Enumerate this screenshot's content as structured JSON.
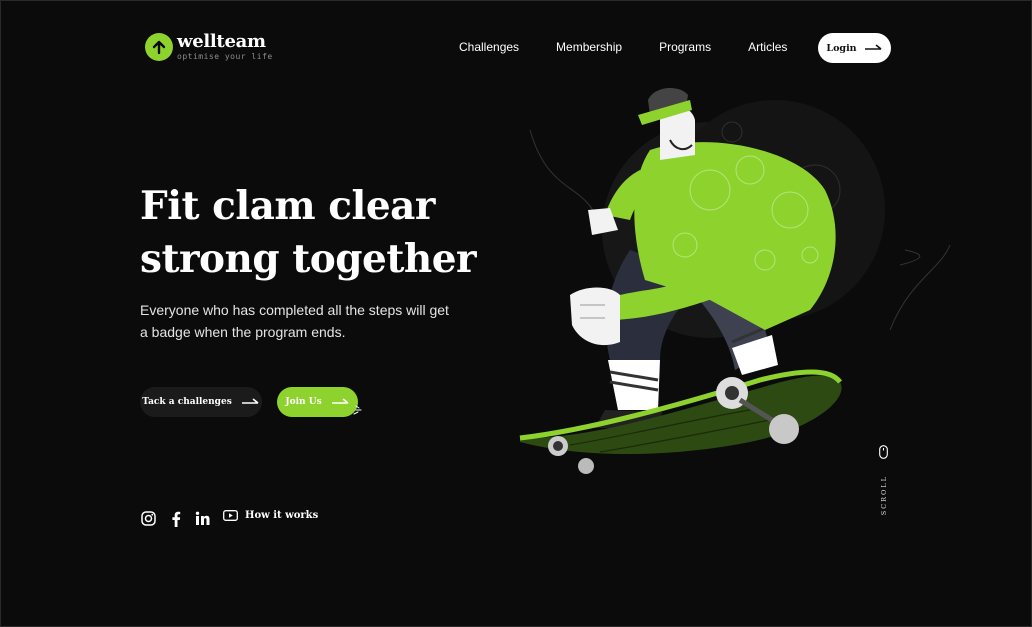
{
  "brand": {
    "name": "wellteam",
    "tagline": "optimise your life",
    "accent": "#8ed22d"
  },
  "nav": {
    "items": [
      "Challenges",
      "Membership",
      "Programs",
      "Articles"
    ],
    "login_label": "Login"
  },
  "hero": {
    "title_line1": "Fit clam clear",
    "title_line2": "strong together",
    "subtitle": "Everyone who has completed all the steps will get a badge when the program ends.",
    "primary_label": "Tack a challenges",
    "secondary_label": "Join Us"
  },
  "footer": {
    "social_icons": [
      "instagram-icon",
      "facebook-icon",
      "linkedin-icon"
    ],
    "video_label": "How it works",
    "scroll_label": "SCROLL"
  },
  "colors": {
    "background": "#0b0b0b",
    "accent": "#8ed22d",
    "text": "#ffffff"
  }
}
